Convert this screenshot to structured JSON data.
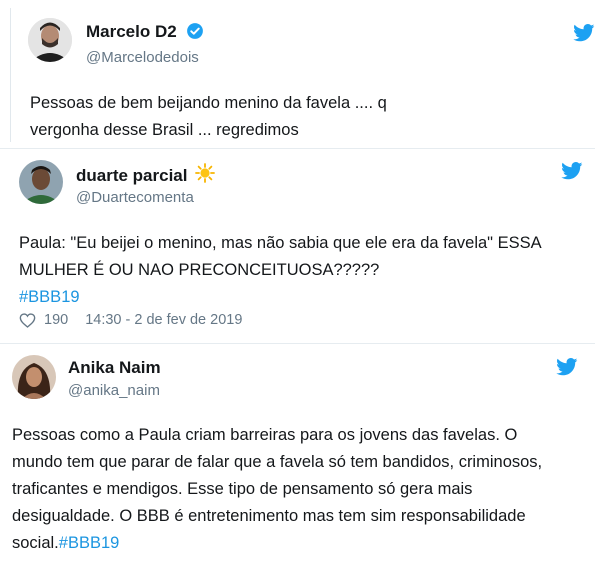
{
  "tweets": [
    {
      "display_name": "Marcelo D2",
      "handle": "@Marcelodedois",
      "verified": true,
      "text": "Pessoas de bem beijando menino da favela .... q vergonha desse Brasil ... regredimos",
      "icon": "twitter-bird-icon"
    },
    {
      "display_name": "duarte parcial",
      "name_emoji": "☀️",
      "handle": "@Duartecomenta",
      "text": "Paula: \"Eu beijei o menino, mas não sabia que ele era da favela\" ESSA MULHER É OU NAO PRECONCEITUOSA?????",
      "hashtag": "#BBB19",
      "likes": "190",
      "timestamp": "14:30 - 2 de fev de 2019",
      "icon": "twitter-bird-icon"
    },
    {
      "display_name": "Anika Naim",
      "handle": "@anika_naim",
      "text": "Pessoas como a Paula criam barreiras para os jovens das favelas. O mundo tem que parar de falar que a favela só tem bandidos, criminosos, traficantes e mendigos. Esse tipo de pensamento só gera mais desigualdade. O BBB é entretenimento mas tem sim responsabilidade social.",
      "hashtag": "#BBB19",
      "icon": "twitter-bird-icon"
    }
  ],
  "colors": {
    "twitter_blue": "#1da1f2",
    "hashtag": "#1b95e0",
    "secondary_text": "#657786"
  }
}
